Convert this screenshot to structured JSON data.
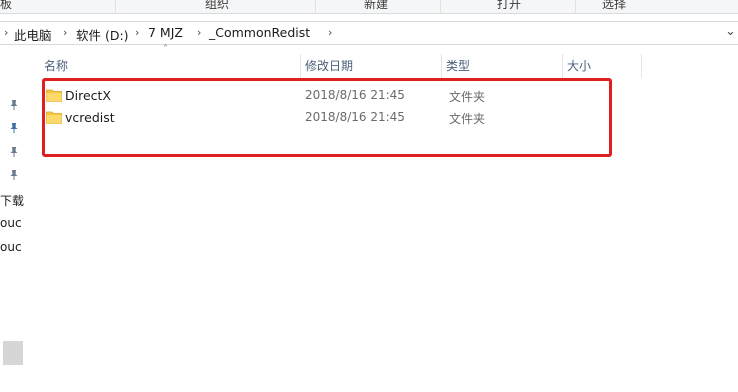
{
  "ribbon": {
    "labels": [
      "板",
      "组织",
      "新建",
      "打开",
      "选择"
    ]
  },
  "address": {
    "crumbs": [
      "此电脑",
      "软件 (D:)",
      "7 MJZ",
      "_CommonRedist"
    ]
  },
  "nav": {
    "pins": [
      "pin-icon",
      "pin-icon",
      "pin-icon",
      "pin-icon"
    ],
    "items": [
      "下载",
      "ouc",
      "ouc"
    ]
  },
  "columns": {
    "name": "名称",
    "modified": "修改日期",
    "type": "类型",
    "size": "大小"
  },
  "files": [
    {
      "name": "DirectX",
      "modified": "2018/8/16 21:45",
      "type": "文件夹",
      "icon": "folder-icon"
    },
    {
      "name": "vcredist",
      "modified": "2018/8/16 21:45",
      "type": "文件夹",
      "icon": "folder-icon"
    }
  ],
  "colors": {
    "highlight": "#e02020",
    "folder": "#f5c842",
    "header_text": "#4c607a"
  }
}
